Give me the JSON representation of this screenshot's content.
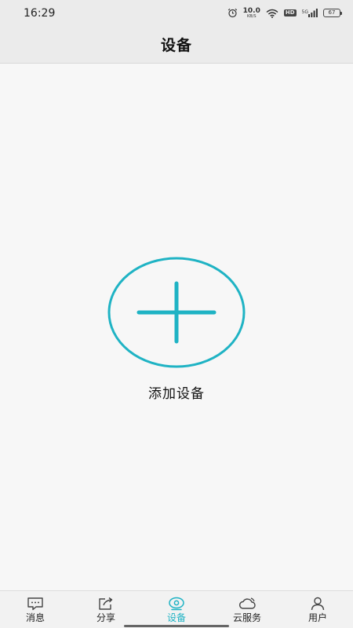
{
  "status_bar": {
    "time": "16:29",
    "net_speed_value": "10.0",
    "net_speed_unit": "KB/S",
    "hd_label": "HD",
    "network_gen": "5G",
    "battery_level": "67",
    "icons": [
      "alarm-icon",
      "wifi-icon",
      "hd-badge",
      "signal-icon",
      "battery-icon"
    ]
  },
  "header": {
    "title": "设备"
  },
  "main": {
    "add_device_label": "添加设备",
    "accent_color": "#1fb3c4"
  },
  "tab_bar": {
    "active_index": 2,
    "tabs": [
      {
        "label": "消息",
        "icon": "message-icon"
      },
      {
        "label": "分享",
        "icon": "share-icon"
      },
      {
        "label": "设备",
        "icon": "camera-eye-icon"
      },
      {
        "label": "云服务",
        "icon": "cloud-icon"
      },
      {
        "label": "用户",
        "icon": "user-icon"
      }
    ]
  }
}
